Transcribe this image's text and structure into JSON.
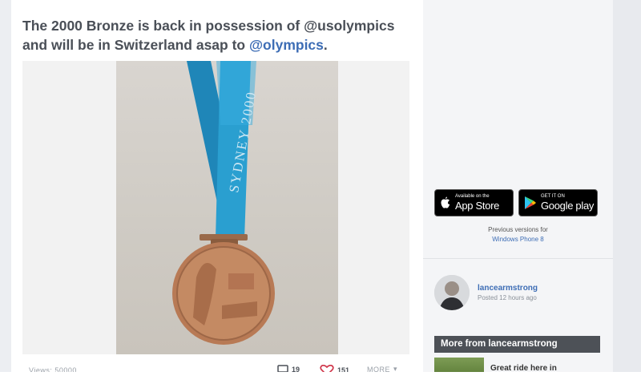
{
  "post": {
    "title_part1": "The 2000 Bronze is back in possession of @usolympics and will be in Switzerland asap to ",
    "title_mention": "@olympics",
    "title_end": ".",
    "image": {
      "ribbon_text": "SYDNEY 2000",
      "ribbon_color": "#2a9fd0",
      "medal_color": "#b87a55"
    },
    "footer": {
      "views": "Views: 50000",
      "comments": "19",
      "likes": "151",
      "more": "MORE"
    }
  },
  "sidebar": {
    "app_store": {
      "small": "Available on the",
      "big": "App Store"
    },
    "google_play": {
      "small": "GET IT ON",
      "big": "Google play"
    },
    "previous_versions": "Previous versions for",
    "windows_phone_link": "Windows Phone 8",
    "author": {
      "name": "lancearmstrong",
      "posted": "Posted 12 hours ago"
    },
    "more_from": "More from lancearmstrong",
    "more_items": [
      {
        "title": "Great ride here in"
      }
    ]
  },
  "colors": {
    "link": "#3d6db5",
    "heading": "#4a4f57",
    "header_bar": "#4d5157"
  }
}
